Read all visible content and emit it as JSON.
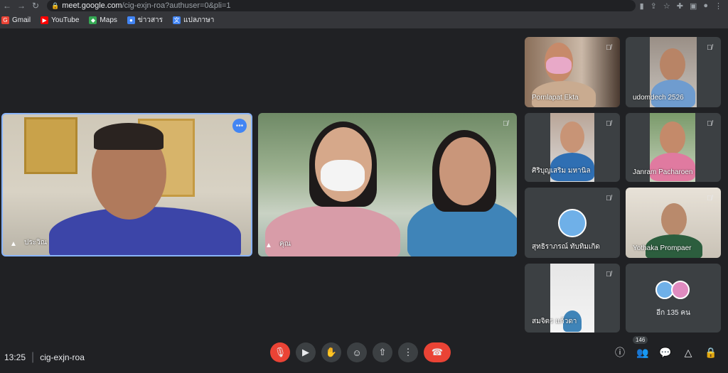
{
  "browser": {
    "url_domain": "meet.google.com",
    "url_path": "/cig-exjn-roa?authuser=0&pli=1"
  },
  "bookmarks": [
    {
      "label": "Gmail",
      "icon": "gmail-icon",
      "color": "#ea4335"
    },
    {
      "label": "YouTube",
      "icon": "youtube-icon",
      "color": "#ff0000"
    },
    {
      "label": "Maps",
      "icon": "maps-icon",
      "color": "#34a853"
    },
    {
      "label": "ข่าวสาร",
      "icon": "news-icon",
      "color": "#4285f4"
    },
    {
      "label": "แปลภาษา",
      "icon": "translate-icon",
      "color": "#4285f4"
    }
  ],
  "main_tiles": [
    {
      "name": "ประวิณ"
    },
    {
      "name": "คุณ"
    }
  ],
  "side_tiles": [
    {
      "name": "Pornlapat Ekta"
    },
    {
      "name": "udomdech 2526"
    },
    {
      "name": "ศิริบุญเสริม มหานิล"
    },
    {
      "name": "Janram Pacharoen"
    },
    {
      "name": "สุทธิราภรณ์ ทับทิมเกิด"
    },
    {
      "name": "Yothaka Prompaer"
    },
    {
      "name": "สมจิตร แก้วดา"
    }
  ],
  "others_tile": {
    "label": "อีก 135 คน"
  },
  "meeting": {
    "time": "13:25",
    "code": "cig-exjn-roa",
    "participants_count": "146"
  },
  "colors": {
    "accent": "#8ab4f8",
    "danger": "#ea4335",
    "bg": "#202124"
  }
}
